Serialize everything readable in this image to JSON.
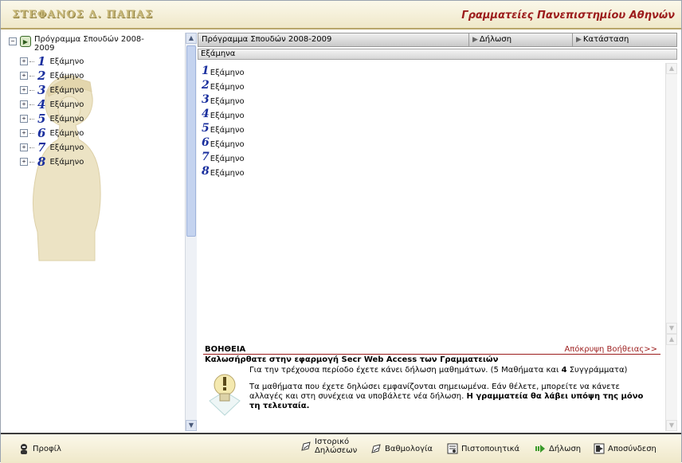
{
  "header": {
    "user_name": "ΣΤΕΦΑΝΟΣ Δ. ΠΑΠΑΣ",
    "site_title": "Γραμματείες Πανεπιστημίου Αθηνών"
  },
  "tree": {
    "root_label": "Πρόγραμμα Σπουδών 2008-2009",
    "items": [
      {
        "num": "1",
        "label": "Εξάμηνο"
      },
      {
        "num": "2",
        "label": "Εξάμηνο"
      },
      {
        "num": "3",
        "label": "Εξάμηνο"
      },
      {
        "num": "4",
        "label": "Εξάμηνο"
      },
      {
        "num": "5",
        "label": "Εξάμηνο"
      },
      {
        "num": "6",
        "label": "Εξάμηνο"
      },
      {
        "num": "7",
        "label": "Εξάμηνο"
      },
      {
        "num": "8",
        "label": "Εξάμηνο"
      }
    ]
  },
  "tabs": {
    "program": "Πρόγραμμα Σπουδών 2008-2009",
    "declaration": "Δήλωση",
    "status": "Κατάσταση"
  },
  "subheader": "Εξάμηνα",
  "semesters": [
    {
      "num": "1",
      "label": "Εξάμηνο"
    },
    {
      "num": "2",
      "label": "Εξάμηνο"
    },
    {
      "num": "3",
      "label": "Εξάμηνο"
    },
    {
      "num": "4",
      "label": "Εξάμηνο"
    },
    {
      "num": "5",
      "label": "Εξάμηνο"
    },
    {
      "num": "6",
      "label": "Εξάμηνο"
    },
    {
      "num": "7",
      "label": "Εξάμηνο"
    },
    {
      "num": "8",
      "label": "Εξάμηνο"
    }
  ],
  "help": {
    "title": "ΒΟΗΘΕΙΑ",
    "hide_link": "Απόκρυψη Βοήθειας>>",
    "welcome": "Καλωσήρθατε στην εφαρμογή Secr Web Access των Γραμματειών",
    "p1_pre": "Για την τρέχουσα περίοδο έχετε κάνει δήλωση μαθημάτων. (",
    "courses_count": "5",
    "p1_mid": " Μαθήματα και ",
    "books_count": "4",
    "p1_post": " Συγγράμματα)",
    "p2": "Τα μαθήματα που έχετε δηλώσει εμφανίζονται σημειωμένα. Εάν θέλετε, μπορείτε να κάνετε αλλαγές και στη συνέχεια να υποβάλετε νέα δήλωση. ",
    "p2_bold": "Η γραμματεία θα λάβει υπόψη της μόνο τη τελευταία."
  },
  "bottom": {
    "profile": "Προφίλ",
    "history_line1": "Ιστορικό",
    "history_line2": "Δηλώσεων",
    "grades": "Βαθμολογία",
    "certificates": "Πιστοποιητικά",
    "declaration": "Δήλωση",
    "logout": "Αποσύνδεση"
  },
  "colors": {
    "accent_red": "#9c1c1c",
    "number_blue": "#1a2f9e",
    "header_beige": "#efe8c9"
  }
}
